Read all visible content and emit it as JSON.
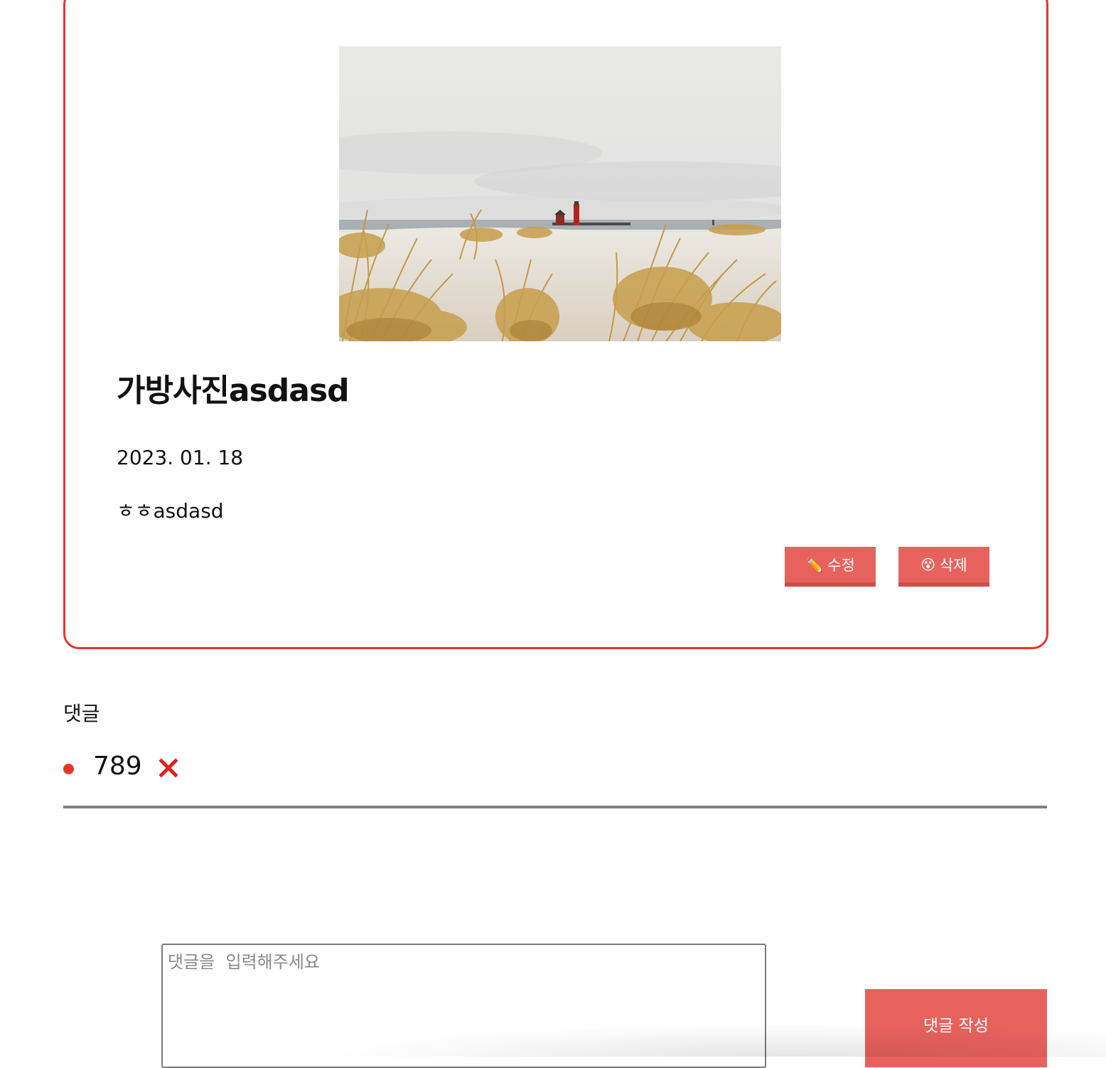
{
  "post": {
    "title": "가방사진asdasd",
    "date": "2023. 01. 18",
    "body": "ㅎㅎasdasd",
    "edit_icon": "✏️",
    "edit_label": "수정",
    "delete_icon": "😵",
    "delete_label": "삭제"
  },
  "comments": {
    "heading": "댓글",
    "items": [
      {
        "text": "789"
      }
    ]
  },
  "comment_form": {
    "placeholder": "댓글을  입력해주세요",
    "submit_label": "댓글 작성"
  },
  "colors": {
    "accent": "#e2382c",
    "button": "#e8625d",
    "divider": "#808080"
  }
}
